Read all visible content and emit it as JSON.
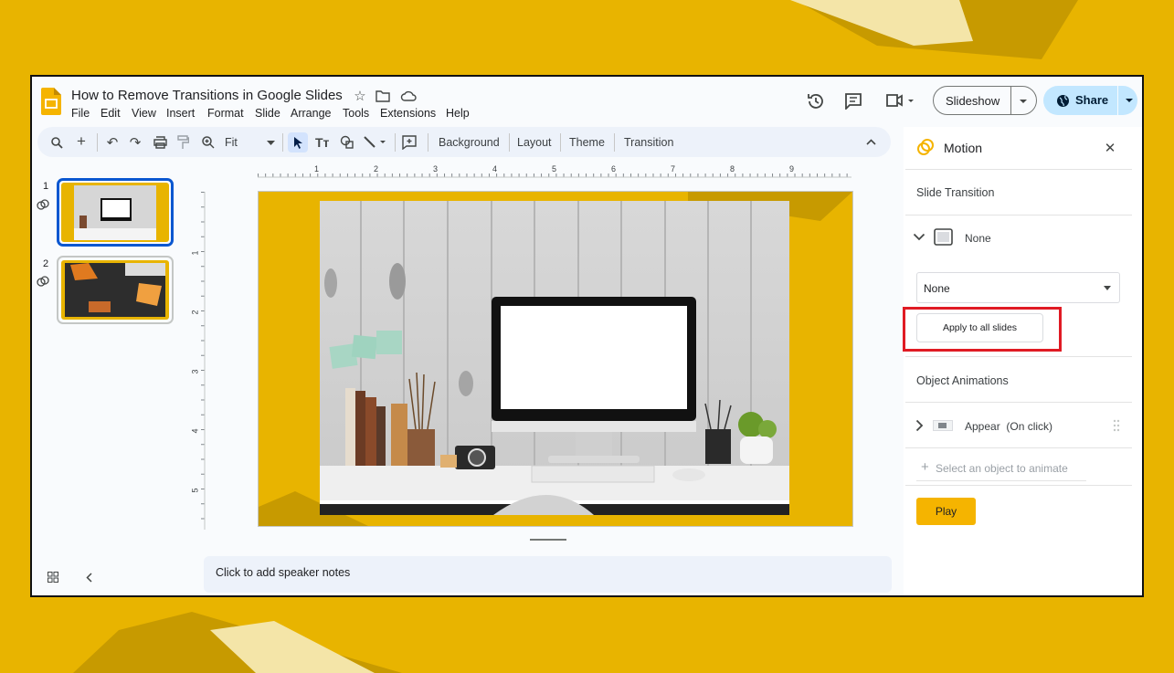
{
  "doc": {
    "title": "How to Remove Transitions in Google Slides"
  },
  "menu": [
    "File",
    "Edit",
    "View",
    "Insert",
    "Format",
    "Slide",
    "Arrange",
    "Tools",
    "Extensions",
    "Help"
  ],
  "header": {
    "slideshow_label": "Slideshow",
    "share_label": "Share"
  },
  "toolbar": {
    "zoom_value": "Fit",
    "background_label": "Background",
    "layout_label": "Layout",
    "theme_label": "Theme",
    "transition_label": "Transition"
  },
  "ruler": {
    "h_ticks": [
      "1",
      "2",
      "3",
      "4",
      "5",
      "6",
      "7",
      "8",
      "9"
    ],
    "v_ticks": [
      "1",
      "2",
      "3",
      "4",
      "5"
    ]
  },
  "filmstrip": {
    "slides": [
      {
        "number": "1"
      },
      {
        "number": "2"
      }
    ]
  },
  "notes": {
    "placeholder": "Click to add speaker notes"
  },
  "motion": {
    "title": "Motion",
    "slide_transition_label": "Slide Transition",
    "transition_name": "None",
    "transition_select_value": "None",
    "apply_all_label": "Apply to all slides",
    "object_animations_label": "Object Animations",
    "animation_item_label": "Appear  (On click)",
    "select_object_label": "Select an object to animate",
    "play_label": "Play"
  },
  "colors": {
    "background": "#E8B400",
    "accent_blue": "#0B57D0",
    "share_bg": "#C2E7FF",
    "highlight_red": "#E01B24",
    "play_yellow": "#F5B400"
  }
}
